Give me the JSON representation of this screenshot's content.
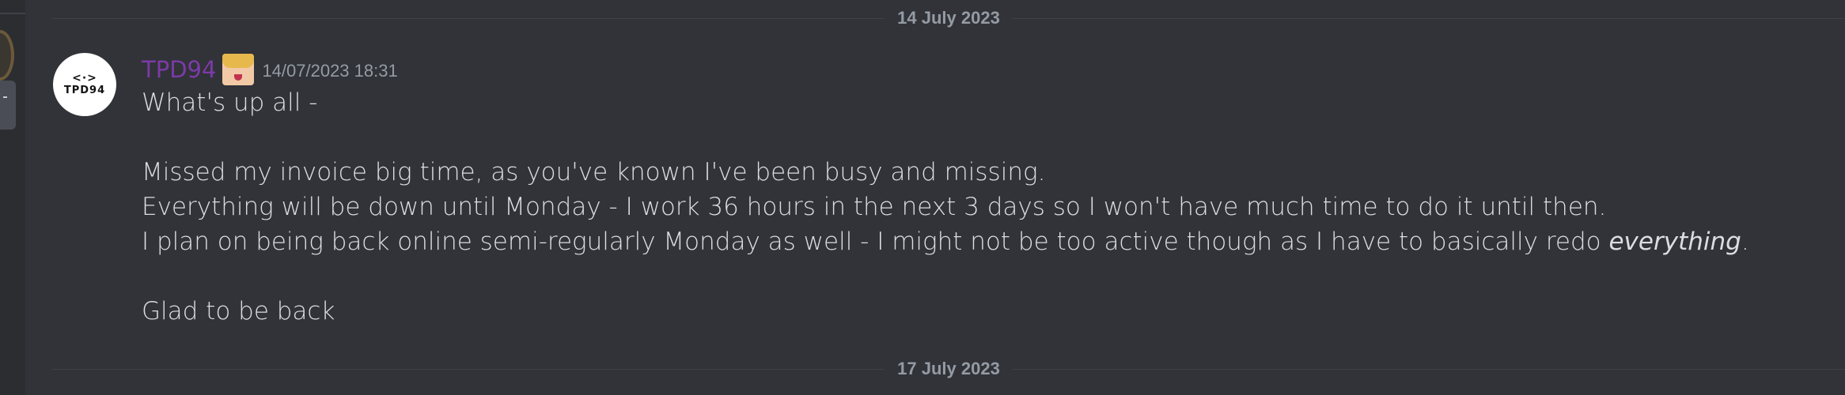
{
  "dividers": {
    "first": "14 July 2023",
    "second": "17 July 2023"
  },
  "message": {
    "avatar": {
      "glyph": "<·>",
      "text": "TPD94"
    },
    "username": "TPD94",
    "username_color": "#7c3aa8",
    "role_icon": "anime-character-icon",
    "timestamp": "14/07/2023 18:31",
    "lines": {
      "l1": "What's up all -",
      "l2": "Missed my invoice big time, as you've known I've been busy and missing.",
      "l3": "Everything will be down until Monday - I work 36 hours in the next 3 days so I won't have much time to do it until then.",
      "l4_before": "I plan on being back online semi-regularly Monday as well - I might not be too active though as I have to basically redo ",
      "l4_em": "everything",
      "l4_after": ".",
      "l5": "Glad to be back"
    }
  }
}
